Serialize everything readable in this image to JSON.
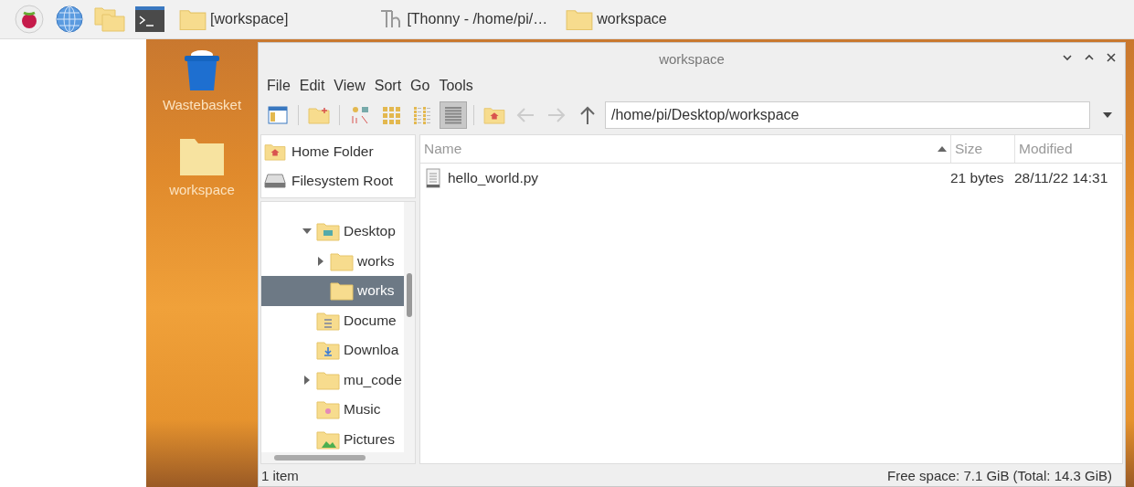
{
  "taskbar": {
    "launchers": [
      {
        "kind": "raspberry"
      },
      {
        "kind": "globe"
      },
      {
        "kind": "folders"
      },
      {
        "kind": "terminal"
      }
    ],
    "tasks": [
      {
        "label": "[workspace]",
        "kind": "folder"
      },
      {
        "label": "[Thonny  -  /home/pi/…",
        "kind": "thonny"
      },
      {
        "label": "workspace",
        "kind": "folder"
      }
    ]
  },
  "desktop_icons": [
    {
      "label": "Wastebasket",
      "kind": "trash"
    },
    {
      "label": "workspace",
      "kind": "folder"
    }
  ],
  "window": {
    "title": "workspace",
    "menu": [
      "File",
      "Edit",
      "View",
      "Sort",
      "Go",
      "Tools"
    ],
    "toolbar": {
      "view_buttons": [
        {
          "kind": "icons",
          "selected": false
        },
        {
          "kind": "thumbnails",
          "selected": false
        },
        {
          "kind": "compact",
          "selected": false
        },
        {
          "kind": "list",
          "selected": true
        }
      ],
      "nav_buttons": [
        {
          "kind": "back",
          "disabled": true
        },
        {
          "kind": "forward",
          "disabled": true
        },
        {
          "kind": "up",
          "disabled": false
        }
      ],
      "path": "/home/pi/Desktop/workspace"
    },
    "places": [
      {
        "label": "Home Folder",
        "kind": "home"
      },
      {
        "label": "Filesystem Root",
        "kind": "drive"
      }
    ],
    "tree": [
      {
        "label": "Desktop",
        "kind": "desktop",
        "expanded": true,
        "selected": false,
        "children": [
          {
            "label": "works",
            "kind": "folder",
            "expanded": false,
            "selected": false
          },
          {
            "label": "works",
            "kind": "folder",
            "selected": true
          }
        ]
      },
      {
        "label": "Docume",
        "kind": "documents",
        "selected": false
      },
      {
        "label": "Downloa",
        "kind": "downloads",
        "selected": false
      },
      {
        "label": "mu_code",
        "kind": "folder",
        "expanded": false,
        "selected": false
      },
      {
        "label": "Music",
        "kind": "music",
        "selected": false
      },
      {
        "label": "Pictures",
        "kind": "pictures",
        "selected": false
      }
    ],
    "columns": [
      {
        "label": "Name",
        "sorted": true
      },
      {
        "label": "Size",
        "sorted": false
      },
      {
        "label": "Modified",
        "sorted": false
      }
    ],
    "files": [
      {
        "name": "hello_world.py",
        "size": "21 bytes",
        "modified": "28/11/22 14:31",
        "kind": "text"
      }
    ],
    "status": {
      "count": "1 item",
      "free_space": "Free space: 7.1 GiB (Total: 14.3 GiB)"
    }
  }
}
